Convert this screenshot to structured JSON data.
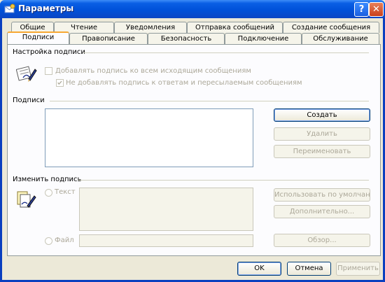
{
  "window": {
    "title": "Параметры"
  },
  "tabs_row1": [
    "Общие",
    "Чтение",
    "Уведомления",
    "Отправка сообщений",
    "Создание сообщения"
  ],
  "tabs_row2": [
    "Подписи",
    "Правописание",
    "Безопасность",
    "Подключение",
    "Обслуживание"
  ],
  "active_tab": "Подписи",
  "sections": {
    "settings": "Настройка подписи",
    "signatures": "Подписи",
    "edit": "Изменить подпись"
  },
  "checkboxes": {
    "add_all": "Добавлять подпись ко всем исходящим сообщениям",
    "no_replies": "Не добавлять подпись к ответам и пересылаемым сообщениям"
  },
  "buttons": {
    "create": "Создать",
    "delete": "Удалить",
    "rename": "Переименовать",
    "default": "Использовать по умолчанию",
    "advanced": "Дополнительно...",
    "browse": "Обзор...",
    "ok": "OK",
    "cancel": "Отмена",
    "apply": "Применить"
  },
  "radios": {
    "text": "Текст",
    "file": "Файл"
  }
}
